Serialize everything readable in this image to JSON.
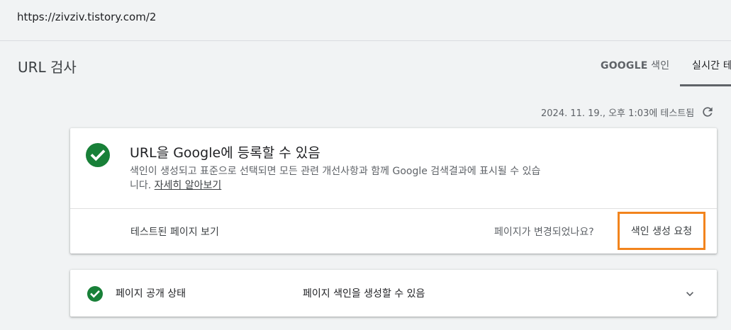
{
  "url_bar": {
    "url": "https://zivziv.tistory.com/2"
  },
  "header": {
    "title": "URL 검사",
    "tabs": [
      {
        "label_bold": "GOOGLE",
        "label_suffix": " 색인"
      },
      {
        "label": "실시간 테"
      }
    ]
  },
  "test_info": {
    "tested_time": "2024. 11. 19., 오후 1:03에 테스트됨",
    "refresh_icon": "refresh-icon"
  },
  "status_card": {
    "icon": "check-circle-icon",
    "title": "URL을 Google에 등록할 수 있음",
    "description": "색인이 생성되고 표준으로 선택되면 모든 관련 개선사항과 함께 Google 검색결과에 표시될 수 있습니다.",
    "learn_more": "자세히 알아보기",
    "view_tested_page": "테스트된 페이지 보기",
    "page_changed": "페이지가 변경되었나요?",
    "request_indexing": "색인 생성 요청"
  },
  "availability_card": {
    "icon": "check-circle-icon",
    "label": "페이지 공개 상태",
    "value": "페이지 색인을 생성할 수 있음",
    "expand_icon": "chevron-down-icon"
  },
  "colors": {
    "success_green": "#188038",
    "highlight_orange": "#f2841d",
    "background": "#f1f3f4"
  }
}
